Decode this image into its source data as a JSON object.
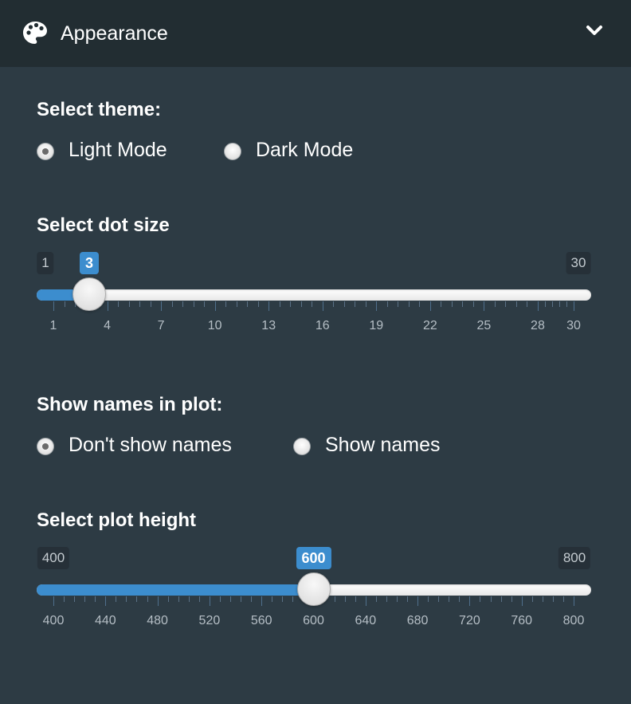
{
  "header": {
    "title": "Appearance",
    "palette_icon": "palette-icon",
    "collapse_icon": "chevron-down-icon"
  },
  "theme": {
    "label": "Select theme:",
    "options": [
      "Light Mode",
      "Dark Mode"
    ],
    "selected": "Light Mode"
  },
  "dot_size": {
    "label": "Select dot size",
    "min": 1,
    "max": 30,
    "value": 3,
    "min_label": "1",
    "max_label": "30",
    "value_label": "3",
    "tick_labels": [
      "1",
      "4",
      "7",
      "10",
      "13",
      "16",
      "19",
      "22",
      "25",
      "28",
      "30"
    ]
  },
  "names": {
    "label": "Show names in plot:",
    "options": [
      "Don't show names",
      "Show names"
    ],
    "selected": "Don't show names"
  },
  "plot_height": {
    "label": "Select plot height",
    "min": 400,
    "max": 800,
    "value": 600,
    "min_label": "400",
    "max_label": "800",
    "value_label": "600",
    "tick_labels": [
      "400",
      "440",
      "480",
      "520",
      "560",
      "600",
      "640",
      "680",
      "720",
      "760",
      "800"
    ]
  },
  "colors": {
    "background": "#2d3b44",
    "header": "#222d32",
    "accent": "#3c8dce"
  }
}
